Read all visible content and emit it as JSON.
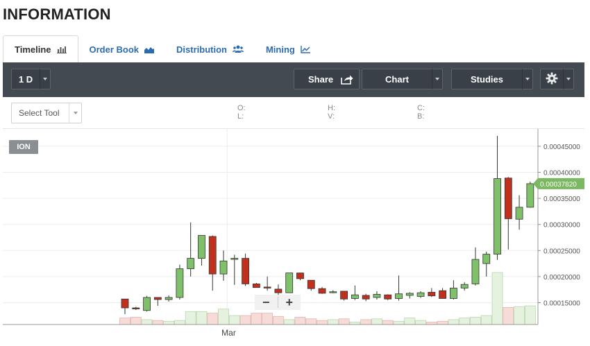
{
  "page_title": "INFORMATION",
  "tabs": [
    {
      "label": "Timeline",
      "icon": "bar-chart-icon"
    },
    {
      "label": "Order Book",
      "icon": "area-chart-icon"
    },
    {
      "label": "Distribution",
      "icon": "users-icon"
    },
    {
      "label": "Mining",
      "icon": "line-chart-icon"
    }
  ],
  "toolbar": {
    "interval_label": "1 D",
    "share_label": "Share",
    "chart_label": "Chart",
    "studies_label": "Studies",
    "settings_icon": "gear-icon"
  },
  "subbar": {
    "select_tool_label": "Select Tool",
    "ohlc_labels": {
      "o": "O:",
      "l": "L:",
      "h": "H:",
      "v": "V:",
      "c": "C:",
      "b": "B:"
    }
  },
  "colors": {
    "toolbar_bg": "#434a52",
    "up": "#7fc06a",
    "down": "#c0301c",
    "current_price_bg": "#7ab861",
    "link": "#2b6cb0"
  },
  "chart_data": {
    "type": "candlestick",
    "symbol": "ION",
    "x_tick_labels": [
      "Mar"
    ],
    "y_tick_labels": [
      "0.00015000",
      "0.00020000",
      "0.00025000",
      "0.00030000",
      "0.00035000",
      "0.00040000",
      "0.00045000"
    ],
    "ylim": [
      0.00011,
      0.00049
    ],
    "current_price": "0.00037820",
    "grid": true,
    "candles": [
      {
        "o": 0.000157,
        "h": 0.000157,
        "l": 0.000128,
        "c": 0.00014
      },
      {
        "o": 0.00014,
        "h": 0.000142,
        "l": 0.000136,
        "c": 0.000138
      },
      {
        "o": 0.000135,
        "h": 0.000163,
        "l": 0.000133,
        "c": 0.00016
      },
      {
        "o": 0.00016,
        "h": 0.00016,
        "l": 0.000144,
        "c": 0.000156
      },
      {
        "o": 0.000156,
        "h": 0.000164,
        "l": 0.000152,
        "c": 0.00016
      },
      {
        "o": 0.00016,
        "h": 0.000223,
        "l": 0.000156,
        "c": 0.000215
      },
      {
        "o": 0.000215,
        "h": 0.000304,
        "l": 0.0002,
        "c": 0.000235
      },
      {
        "o": 0.000235,
        "h": 0.000279,
        "l": 0.000221,
        "c": 0.000279
      },
      {
        "o": 0.000277,
        "h": 0.000279,
        "l": 0.000173,
        "c": 0.000205
      },
      {
        "o": 0.000205,
        "h": 0.00025,
        "l": 0.000192,
        "c": 0.00023
      },
      {
        "o": 0.000234,
        "h": 0.000242,
        "l": 0.000184,
        "c": 0.000235
      },
      {
        "o": 0.000235,
        "h": 0.000244,
        "l": 0.000182,
        "c": 0.000186
      },
      {
        "o": 0.000186,
        "h": 0.000188,
        "l": 0.000179,
        "c": 0.000179
      },
      {
        "o": 0.00018,
        "h": 0.0002,
        "l": 0.000173,
        "c": 0.000178
      },
      {
        "o": 0.000176,
        "h": 0.000185,
        "l": 0.000162,
        "c": 0.000169
      },
      {
        "o": 0.000169,
        "h": 0.000207,
        "l": 0.000169,
        "c": 0.000207
      },
      {
        "o": 0.000207,
        "h": 0.000207,
        "l": 0.000193,
        "c": 0.000196
      },
      {
        "o": 0.000193,
        "h": 0.000193,
        "l": 0.000173,
        "c": 0.000177
      },
      {
        "o": 0.000177,
        "h": 0.00018,
        "l": 0.000167,
        "c": 0.000168
      },
      {
        "o": 0.00017,
        "h": 0.000174,
        "l": 0.000168,
        "c": 0.000171
      },
      {
        "o": 0.000172,
        "h": 0.000172,
        "l": 0.000154,
        "c": 0.000157
      },
      {
        "o": 0.000158,
        "h": 0.000183,
        "l": 0.000155,
        "c": 0.000165
      },
      {
        "o": 0.000164,
        "h": 0.000167,
        "l": 0.000153,
        "c": 0.000157
      },
      {
        "o": 0.00016,
        "h": 0.000172,
        "l": 0.000156,
        "c": 0.000166
      },
      {
        "o": 0.000165,
        "h": 0.000166,
        "l": 0.000155,
        "c": 0.000157
      },
      {
        "o": 0.000158,
        "h": 0.000202,
        "l": 0.000154,
        "c": 0.000167
      },
      {
        "o": 0.000164,
        "h": 0.00017,
        "l": 0.000158,
        "c": 0.000168
      },
      {
        "o": 0.000162,
        "h": 0.000172,
        "l": 0.000159,
        "c": 0.000169
      },
      {
        "o": 0.00017,
        "h": 0.000178,
        "l": 0.000161,
        "c": 0.000163
      },
      {
        "o": 0.000173,
        "h": 0.000178,
        "l": 0.00016,
        "c": 0.000158
      },
      {
        "o": 0.000158,
        "h": 0.000193,
        "l": 0.000156,
        "c": 0.000178
      },
      {
        "o": 0.000178,
        "h": 0.000189,
        "l": 0.000173,
        "c": 0.000185
      },
      {
        "o": 0.000186,
        "h": 0.000256,
        "l": 0.000183,
        "c": 0.000233
      },
      {
        "o": 0.000225,
        "h": 0.000248,
        "l": 0.0002,
        "c": 0.000243
      },
      {
        "o": 0.000243,
        "h": 0.00047,
        "l": 0.000232,
        "c": 0.000388
      },
      {
        "o": 0.000389,
        "h": 0.000391,
        "l": 0.000252,
        "c": 0.000311
      },
      {
        "o": 0.00031,
        "h": 0.000356,
        "l": 0.00029,
        "c": 0.000333
      },
      {
        "o": 0.000333,
        "h": 0.000382,
        "l": 0.000332,
        "c": 0.0003782
      }
    ],
    "volumes": [
      8,
      9,
      6,
      5,
      4,
      5,
      16,
      16,
      14,
      19,
      11,
      11,
      14,
      14,
      10,
      6,
      9,
      7,
      5,
      6,
      7,
      3,
      6,
      7,
      5,
      4,
      8,
      5,
      3,
      4,
      6,
      8,
      9,
      11,
      64,
      21,
      22,
      23
    ]
  }
}
